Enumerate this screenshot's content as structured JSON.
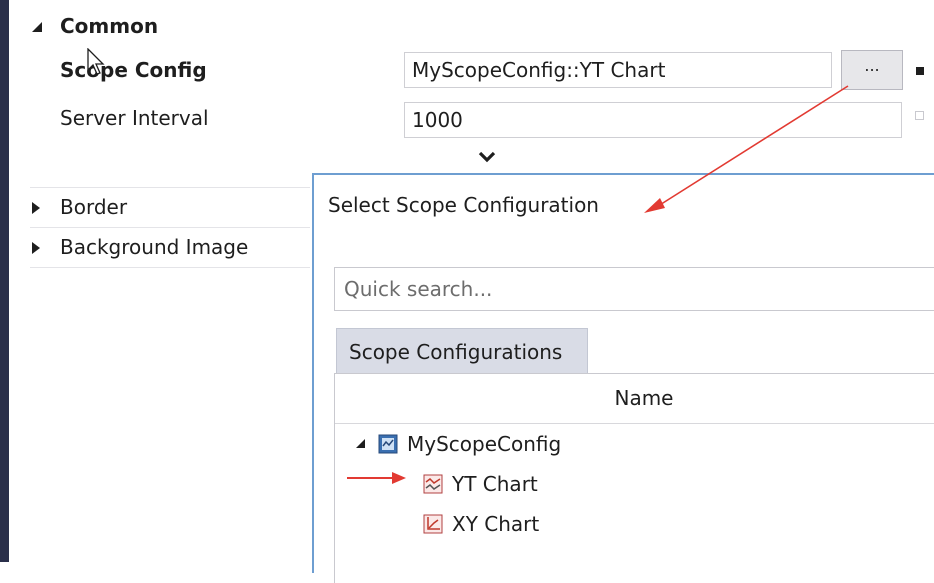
{
  "properties": {
    "common_group": "Common",
    "scope_config_label": "Scope Config",
    "scope_config_value": "MyScopeConfig::YT Chart",
    "ellipsis_label": "...",
    "server_interval_label": "Server Interval",
    "server_interval_value": "1000",
    "border_group": "Border",
    "background_image_group": "Background Image"
  },
  "dialog": {
    "title": "Select Scope Configuration",
    "search_placeholder": "Quick search...",
    "tab_label": "Scope Configurations",
    "column_name": "Name",
    "tree": {
      "root": "MyScopeConfig",
      "children": [
        "YT Chart",
        "XY Chart"
      ]
    }
  },
  "icons": {
    "expanded": "triangle-down-icon",
    "collapsed": "triangle-right-icon",
    "chevron": "chevron-down-icon",
    "scope": "scope-config-icon",
    "yt": "yt-chart-icon",
    "xy": "xy-chart-icon"
  },
  "colors": {
    "accent": "#6e9ed1",
    "left_bar": "#2a2f4a",
    "tab_bg": "#d9dce6",
    "annotation_arrow": "#e23a32"
  }
}
